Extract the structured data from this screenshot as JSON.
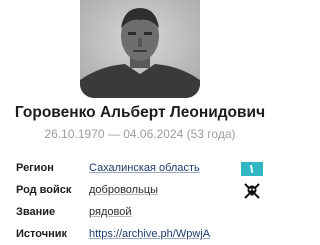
{
  "person": {
    "name": "Горовенко Альберт Леонидович",
    "dates": "26.10.1970 — 04.06.2024 (53 года)"
  },
  "details": {
    "region_label": "Регион",
    "region_value": "Сахалинская область",
    "region_flag_color": "#2fb8c4",
    "branch_label": "Род войск",
    "branch_value": "добровольцы",
    "branch_icon": "crossed-swords-skull-icon",
    "rank_label": "Звание",
    "rank_value": "рядовой",
    "source_label": "Источник",
    "source_value": "https://archive.ph/WpwjA"
  }
}
